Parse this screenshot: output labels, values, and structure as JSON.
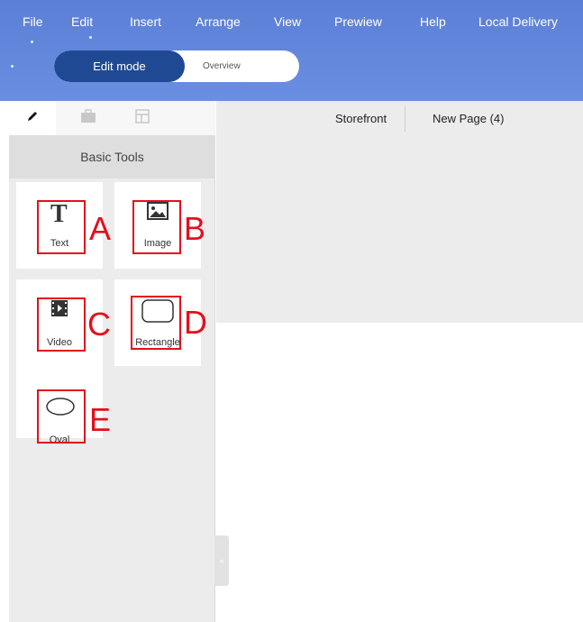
{
  "menu": {
    "items": [
      "File",
      "Edit",
      "Insert",
      "Arrange",
      "View",
      "Prewiew",
      "Help",
      "Local Delivery"
    ]
  },
  "mode": {
    "active_label": "Edit mode",
    "inactive_label": "Overview"
  },
  "panel": {
    "tabs": [
      {
        "icon": "pencil-icon"
      },
      {
        "icon": "briefcase-icon"
      },
      {
        "icon": "layout-icon"
      }
    ],
    "title": "Basic Tools",
    "tools": [
      {
        "label": "Text",
        "icon": "text-icon",
        "marker": "A"
      },
      {
        "label": "Image",
        "icon": "image-icon",
        "marker": "B"
      },
      {
        "label": "Video",
        "icon": "video-icon",
        "marker": "C"
      },
      {
        "label": "Rectangle",
        "icon": "rectangle-icon",
        "marker": "D"
      },
      {
        "label": "Oval",
        "icon": "oval-icon",
        "marker": "E"
      }
    ]
  },
  "pages": {
    "tabs": [
      "Storefront",
      "New Page (4)"
    ]
  },
  "colors": {
    "header": "#5b7fd6",
    "toggle_active": "#1f4a93",
    "annotation": "#e3101b"
  }
}
